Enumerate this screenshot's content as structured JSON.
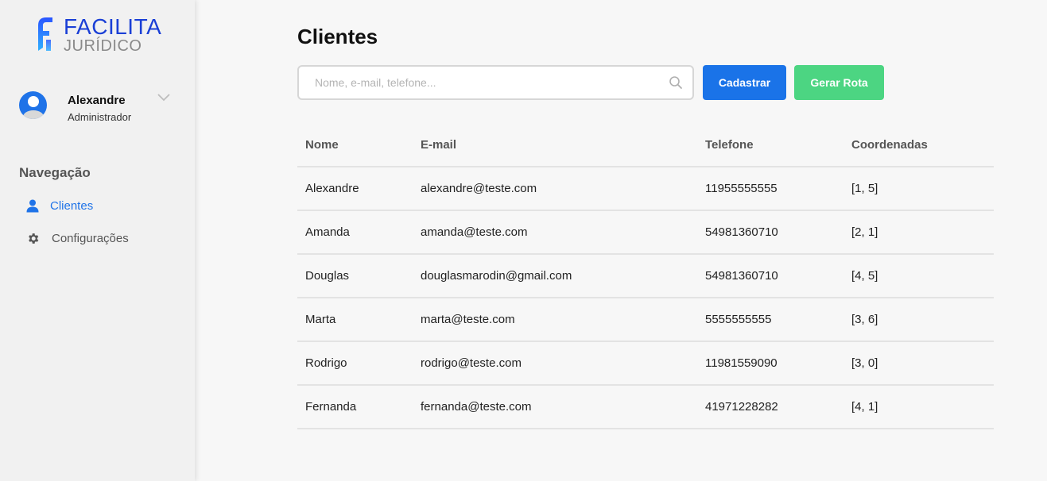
{
  "brand": {
    "line1": "FACILITA",
    "line2": "JURÍDICO"
  },
  "user": {
    "name": "Alexandre",
    "role": "Administrador"
  },
  "nav": {
    "title": "Navegação",
    "items": [
      {
        "label": "Clientes",
        "icon": "user-icon",
        "active": true
      },
      {
        "label": "Configurações",
        "icon": "gear-icon",
        "active": false
      }
    ]
  },
  "page": {
    "title": "Clientes"
  },
  "search": {
    "placeholder": "Nome, e-mail, telefone...",
    "value": ""
  },
  "actions": {
    "cadastrar": "Cadastrar",
    "gerar_rota": "Gerar Rota"
  },
  "colors": {
    "primary": "#1a73e8",
    "success": "#4cd582",
    "brand": "#1a3fd6"
  },
  "table": {
    "headers": [
      "Nome",
      "E-mail",
      "Telefone",
      "Coordenadas"
    ],
    "rows": [
      [
        "Alexandre",
        "alexandre@teste.com",
        "11955555555",
        "[1, 5]"
      ],
      [
        "Amanda",
        "amanda@teste.com",
        "54981360710",
        "[2, 1]"
      ],
      [
        "Douglas",
        "douglasmarodin@gmail.com",
        "54981360710",
        "[4, 5]"
      ],
      [
        "Marta",
        "marta@teste.com",
        "5555555555",
        "[3, 6]"
      ],
      [
        "Rodrigo",
        "rodrigo@teste.com",
        "11981559090",
        "[3, 0]"
      ],
      [
        "Fernanda",
        "fernanda@teste.com",
        "41971228282",
        "[4, 1]"
      ]
    ]
  }
}
